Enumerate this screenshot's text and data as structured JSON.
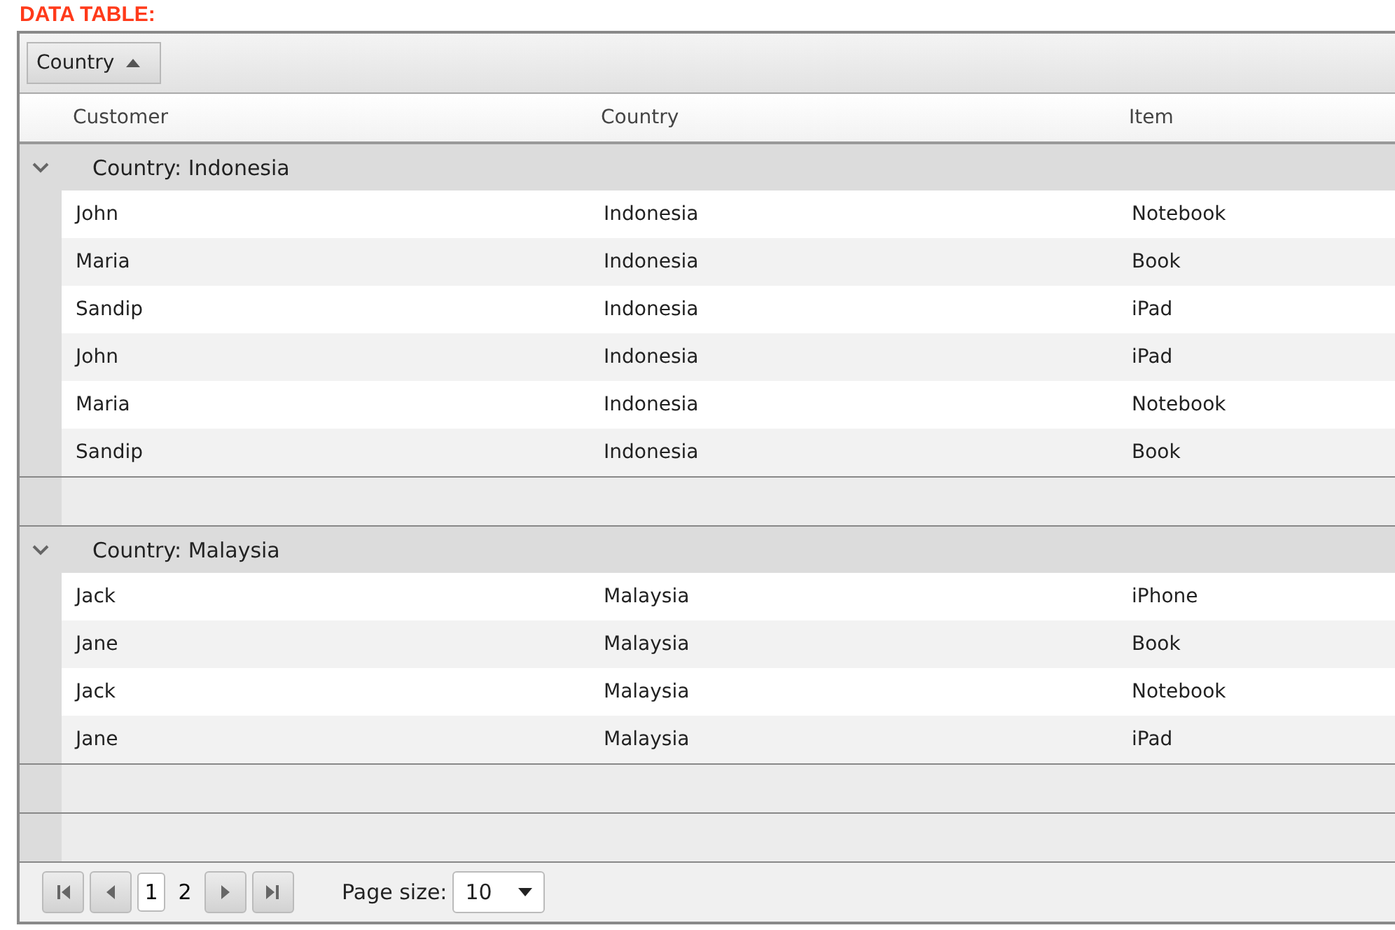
{
  "title": "DATA TABLE:",
  "group_panel": {
    "chip": {
      "label": "Country"
    }
  },
  "table": {
    "columns": [
      "Customer",
      "Country",
      "Item"
    ],
    "groups": [
      {
        "label": "Country: Indonesia",
        "expanded": true,
        "rows": [
          [
            "John",
            "Indonesia",
            "Notebook"
          ],
          [
            "Maria",
            "Indonesia",
            "Book"
          ],
          [
            "Sandip",
            "Indonesia",
            "iPad"
          ],
          [
            "John",
            "Indonesia",
            "iPad"
          ],
          [
            "Maria",
            "Indonesia",
            "Notebook"
          ],
          [
            "Sandip",
            "Indonesia",
            "Book"
          ]
        ]
      },
      {
        "label": "Country: Malaysia",
        "expanded": true,
        "rows": [
          [
            "Jack",
            "Malaysia",
            "iPhone"
          ],
          [
            "Jane",
            "Malaysia",
            "Book"
          ],
          [
            "Jack",
            "Malaysia",
            "Notebook"
          ],
          [
            "Jane",
            "Malaysia",
            "iPad"
          ]
        ]
      }
    ]
  },
  "pager": {
    "pages": [
      {
        "label": "1",
        "selected": true
      },
      {
        "label": "2",
        "selected": false
      }
    ],
    "page_size_label": "Page size:",
    "page_size": "10"
  }
}
